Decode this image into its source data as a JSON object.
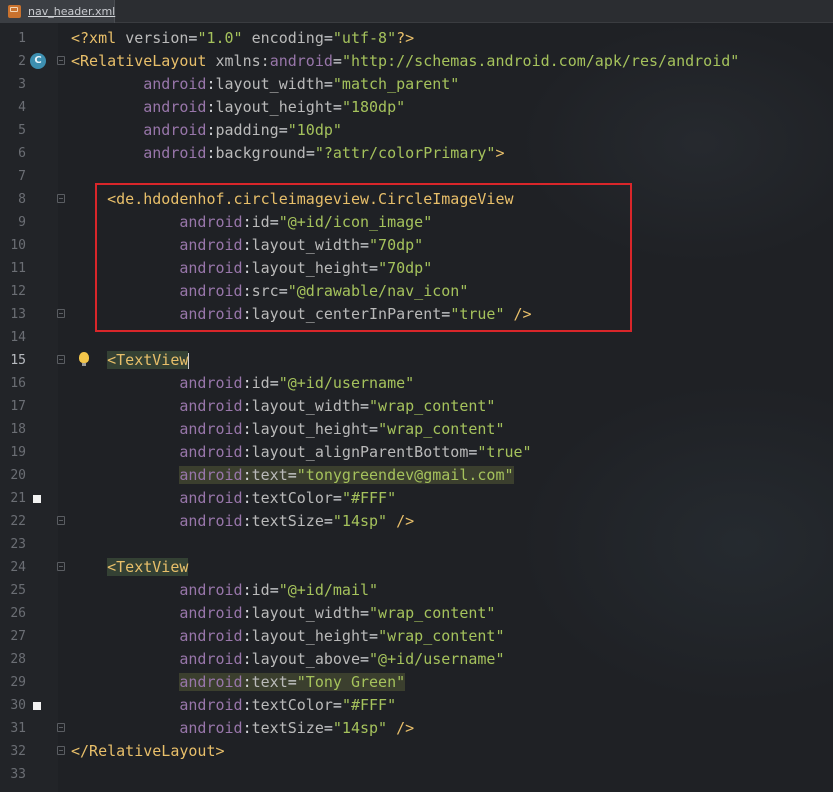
{
  "tab": {
    "label": "nav_header.xml",
    "icon": "xml-file-icon"
  },
  "gutter_badge": "C",
  "lines": [
    {
      "n": "1",
      "tokens": [
        [
          "t",
          "<?xml "
        ],
        [
          "at",
          "version"
        ],
        [
          "pl",
          "="
        ],
        [
          "st",
          "\"1.0\""
        ],
        [
          "at",
          " encoding"
        ],
        [
          "pl",
          "="
        ],
        [
          "st",
          "\"utf-8\""
        ],
        [
          "t",
          "?>"
        ]
      ]
    },
    {
      "n": "2",
      "tokens": [
        [
          "tag",
          "<RelativeLayout "
        ],
        [
          "at",
          "xmlns:"
        ],
        [
          "ns",
          "android"
        ],
        [
          "pl",
          "="
        ],
        [
          "st",
          "\"http://schemas.android.com/apk/res/android\""
        ]
      ]
    },
    {
      "n": "3",
      "indent": "        ",
      "tokens": [
        [
          "ns",
          "android"
        ],
        [
          "pl",
          ":"
        ],
        [
          "at",
          "layout_width"
        ],
        [
          "pl",
          "="
        ],
        [
          "st",
          "\"match_parent\""
        ]
      ]
    },
    {
      "n": "4",
      "indent": "        ",
      "tokens": [
        [
          "ns",
          "android"
        ],
        [
          "pl",
          ":"
        ],
        [
          "at",
          "layout_height"
        ],
        [
          "pl",
          "="
        ],
        [
          "st",
          "\"180dp\""
        ]
      ]
    },
    {
      "n": "5",
      "indent": "        ",
      "tokens": [
        [
          "ns",
          "android"
        ],
        [
          "pl",
          ":"
        ],
        [
          "at",
          "padding"
        ],
        [
          "pl",
          "="
        ],
        [
          "st",
          "\"10dp\""
        ]
      ]
    },
    {
      "n": "6",
      "indent": "        ",
      "tokens": [
        [
          "ns",
          "android"
        ],
        [
          "pl",
          ":"
        ],
        [
          "at",
          "background"
        ],
        [
          "pl",
          "="
        ],
        [
          "st",
          "\"?attr/colorPrimary\""
        ],
        [
          "br",
          ">"
        ]
      ]
    },
    {
      "n": "7",
      "tokens": []
    },
    {
      "n": "8",
      "indent": "    ",
      "tokens": [
        [
          "tag",
          "<de.hdodenhof.circleimageview.CircleImageView"
        ]
      ]
    },
    {
      "n": "9",
      "indent": "            ",
      "tokens": [
        [
          "ns",
          "android"
        ],
        [
          "pl",
          ":"
        ],
        [
          "at",
          "id"
        ],
        [
          "pl",
          "="
        ],
        [
          "st",
          "\"@+id/icon_image\""
        ]
      ]
    },
    {
      "n": "10",
      "indent": "            ",
      "tokens": [
        [
          "ns",
          "android"
        ],
        [
          "pl",
          ":"
        ],
        [
          "at",
          "layout_width"
        ],
        [
          "pl",
          "="
        ],
        [
          "st",
          "\"70dp\""
        ]
      ]
    },
    {
      "n": "11",
      "indent": "            ",
      "tokens": [
        [
          "ns",
          "android"
        ],
        [
          "pl",
          ":"
        ],
        [
          "at",
          "layout_height"
        ],
        [
          "pl",
          "="
        ],
        [
          "st",
          "\"70dp\""
        ]
      ]
    },
    {
      "n": "12",
      "indent": "            ",
      "tokens": [
        [
          "ns",
          "android"
        ],
        [
          "pl",
          ":"
        ],
        [
          "at",
          "src"
        ],
        [
          "pl",
          "="
        ],
        [
          "st",
          "\"@drawable/nav_icon\""
        ]
      ]
    },
    {
      "n": "13",
      "indent": "            ",
      "tokens": [
        [
          "ns",
          "android"
        ],
        [
          "pl",
          ":"
        ],
        [
          "at",
          "layout_centerInParent"
        ],
        [
          "pl",
          "="
        ],
        [
          "st",
          "\"true\""
        ],
        [
          "tag",
          " />"
        ]
      ]
    },
    {
      "n": "14",
      "tokens": []
    },
    {
      "n": "15",
      "indent": "    ",
      "tokens": [
        [
          "tag",
          "<TextView"
        ]
      ]
    },
    {
      "n": "16",
      "indent": "            ",
      "tokens": [
        [
          "ns",
          "android"
        ],
        [
          "pl",
          ":"
        ],
        [
          "at",
          "id"
        ],
        [
          "pl",
          "="
        ],
        [
          "st",
          "\"@+id/username\""
        ]
      ]
    },
    {
      "n": "17",
      "indent": "            ",
      "tokens": [
        [
          "ns",
          "android"
        ],
        [
          "pl",
          ":"
        ],
        [
          "at",
          "layout_width"
        ],
        [
          "pl",
          "="
        ],
        [
          "st",
          "\"wrap_content\""
        ]
      ]
    },
    {
      "n": "18",
      "indent": "            ",
      "tokens": [
        [
          "ns",
          "android"
        ],
        [
          "pl",
          ":"
        ],
        [
          "at",
          "layout_height"
        ],
        [
          "pl",
          "="
        ],
        [
          "st",
          "\"wrap_content\""
        ]
      ]
    },
    {
      "n": "19",
      "indent": "            ",
      "tokens": [
        [
          "ns",
          "android"
        ],
        [
          "pl",
          ":"
        ],
        [
          "at",
          "layout_alignParentBottom"
        ],
        [
          "pl",
          "="
        ],
        [
          "st",
          "\"true\""
        ]
      ]
    },
    {
      "n": "20",
      "indent": "            ",
      "tokens": [
        [
          "ns",
          "android"
        ],
        [
          "pl",
          ":"
        ],
        [
          "at",
          "text"
        ],
        [
          "pl",
          "="
        ],
        [
          "st",
          "\"tonygreendev@gmail.com\""
        ]
      ]
    },
    {
      "n": "21",
      "indent": "            ",
      "tokens": [
        [
          "ns",
          "android"
        ],
        [
          "pl",
          ":"
        ],
        [
          "at",
          "textColor"
        ],
        [
          "pl",
          "="
        ],
        [
          "st",
          "\"#FFF\""
        ]
      ]
    },
    {
      "n": "22",
      "indent": "            ",
      "tokens": [
        [
          "ns",
          "android"
        ],
        [
          "pl",
          ":"
        ],
        [
          "at",
          "textSize"
        ],
        [
          "pl",
          "="
        ],
        [
          "st",
          "\"14sp\""
        ],
        [
          "tag",
          " />"
        ]
      ]
    },
    {
      "n": "23",
      "tokens": []
    },
    {
      "n": "24",
      "indent": "    ",
      "tokens": [
        [
          "tag",
          "<TextView"
        ]
      ]
    },
    {
      "n": "25",
      "indent": "            ",
      "tokens": [
        [
          "ns",
          "android"
        ],
        [
          "pl",
          ":"
        ],
        [
          "at",
          "id"
        ],
        [
          "pl",
          "="
        ],
        [
          "st",
          "\"@+id/mail\""
        ]
      ]
    },
    {
      "n": "26",
      "indent": "            ",
      "tokens": [
        [
          "ns",
          "android"
        ],
        [
          "pl",
          ":"
        ],
        [
          "at",
          "layout_width"
        ],
        [
          "pl",
          "="
        ],
        [
          "st",
          "\"wrap_content\""
        ]
      ]
    },
    {
      "n": "27",
      "indent": "            ",
      "tokens": [
        [
          "ns",
          "android"
        ],
        [
          "pl",
          ":"
        ],
        [
          "at",
          "layout_height"
        ],
        [
          "pl",
          "="
        ],
        [
          "st",
          "\"wrap_content\""
        ]
      ]
    },
    {
      "n": "28",
      "indent": "            ",
      "tokens": [
        [
          "ns",
          "android"
        ],
        [
          "pl",
          ":"
        ],
        [
          "at",
          "layout_above"
        ],
        [
          "pl",
          "="
        ],
        [
          "st",
          "\"@+id/username\""
        ]
      ]
    },
    {
      "n": "29",
      "indent": "            ",
      "tokens": [
        [
          "ns",
          "android"
        ],
        [
          "pl",
          ":"
        ],
        [
          "at",
          "text"
        ],
        [
          "pl",
          "="
        ],
        [
          "st",
          "\"Tony Green\""
        ]
      ]
    },
    {
      "n": "30",
      "indent": "            ",
      "tokens": [
        [
          "ns",
          "android"
        ],
        [
          "pl",
          ":"
        ],
        [
          "at",
          "textColor"
        ],
        [
          "pl",
          "="
        ],
        [
          "st",
          "\"#FFF\""
        ]
      ]
    },
    {
      "n": "31",
      "indent": "            ",
      "tokens": [
        [
          "ns",
          "android"
        ],
        [
          "pl",
          ":"
        ],
        [
          "at",
          "textSize"
        ],
        [
          "pl",
          "="
        ],
        [
          "st",
          "\"14sp\""
        ],
        [
          "tag",
          " />"
        ]
      ]
    },
    {
      "n": "32",
      "tokens": [
        [
          "tag",
          "</RelativeLayout>"
        ]
      ]
    },
    {
      "n": "33",
      "tokens": []
    }
  ],
  "colors": {
    "background": "#1f2125",
    "tag": "#e8bf6a",
    "namespace": "#9876aa",
    "attribute": "#bababa",
    "string": "#a5c25c",
    "highlight_box": "#d9262a"
  }
}
